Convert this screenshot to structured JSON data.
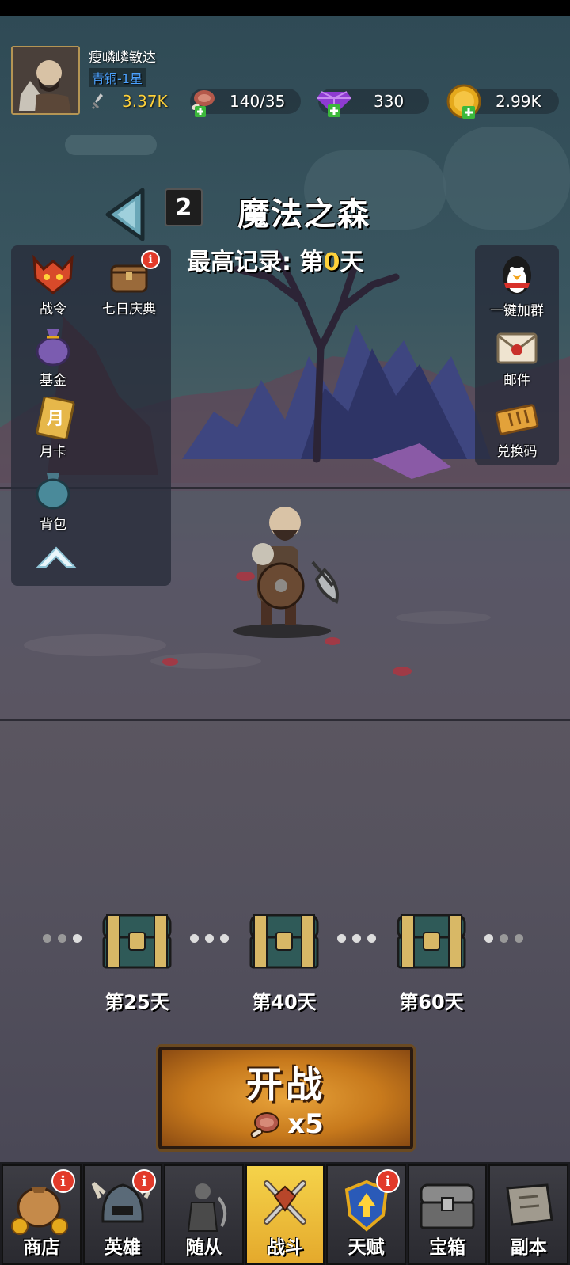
{
  "player": {
    "name": "瘦嶙嶙敏达",
    "rank": "青铜-1星",
    "power": "3.37K"
  },
  "resources": {
    "meat": "140/35",
    "gems": "330",
    "gold": "2.99K"
  },
  "stage": {
    "number": "2",
    "name": "魔法之森",
    "record_prefix": "最高记录: 第",
    "record_value": "0",
    "record_suffix": "天"
  },
  "left_panel": {
    "items": [
      {
        "label": "战令",
        "icon": "battle-pass-icon"
      },
      {
        "label": "七日庆典",
        "icon": "seven-day-chest-icon",
        "badge": "i"
      },
      {
        "label": "基金",
        "icon": "fund-bag-icon"
      },
      {
        "label": "月卡",
        "icon": "month-card-icon",
        "card_char": "月"
      },
      {
        "label": "背包",
        "icon": "backpack-icon"
      }
    ]
  },
  "right_panel": {
    "items": [
      {
        "label": "一键加群",
        "icon": "qq-penguin-icon"
      },
      {
        "label": "邮件",
        "icon": "mail-icon"
      },
      {
        "label": "兑换码",
        "icon": "ticket-icon"
      }
    ]
  },
  "chests": [
    {
      "label": "第25天"
    },
    {
      "label": "第40天"
    },
    {
      "label": "第60天"
    }
  ],
  "start_button": {
    "title": "开战",
    "cost": "x5"
  },
  "nav": {
    "items": [
      {
        "label": "商店",
        "icon": "shop-bag-icon",
        "badge": "i"
      },
      {
        "label": "英雄",
        "icon": "hero-helmet-icon",
        "badge": "i"
      },
      {
        "label": "随从",
        "icon": "follower-icon"
      },
      {
        "label": "战斗",
        "icon": "crossed-swords-icon",
        "active": true
      },
      {
        "label": "天赋",
        "icon": "talent-shield-icon",
        "badge": "i"
      },
      {
        "label": "宝箱",
        "icon": "treasure-chest-icon"
      },
      {
        "label": "副本",
        "icon": "dungeon-scroll-icon"
      }
    ]
  }
}
